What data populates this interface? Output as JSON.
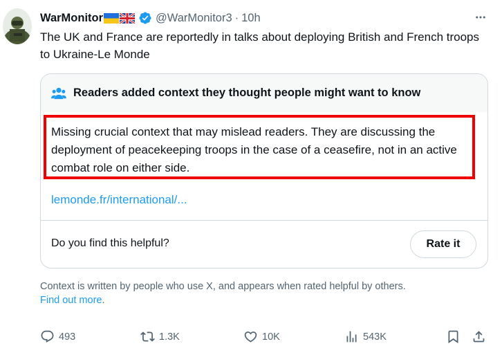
{
  "tweet": {
    "author_name": "WarMonitor",
    "flags": [
      "ukraine-flag",
      "uk-flag"
    ],
    "handle": "@WarMonitor3",
    "separator": "·",
    "time": "10h",
    "text": "The UK and France are reportedly in talks about deploying British and French troops to Ukraine-Le Monde"
  },
  "community_note": {
    "header": "Readers added context they thought people might want to know",
    "body": "Missing crucial context that may mislead readers. They are discussing the deployment of peacekeeping troops in the case of a ceasefire, not in an active combat role on either side.",
    "link": "lemonde.fr/international/...",
    "question": "Do you find this helpful?",
    "rate_button": "Rate it",
    "highlight_color": "#f00000"
  },
  "disclaimer": {
    "text": "Context is written by people who use X, and appears when rated helpful by others.",
    "link": "Find out more",
    "after_link": "."
  },
  "actions": {
    "replies": "493",
    "reposts": "1.3K",
    "likes": "10K",
    "views": "543K"
  },
  "colors": {
    "accent": "#1d9bf0",
    "secondary_text": "#536471",
    "border": "#cfd9de"
  }
}
